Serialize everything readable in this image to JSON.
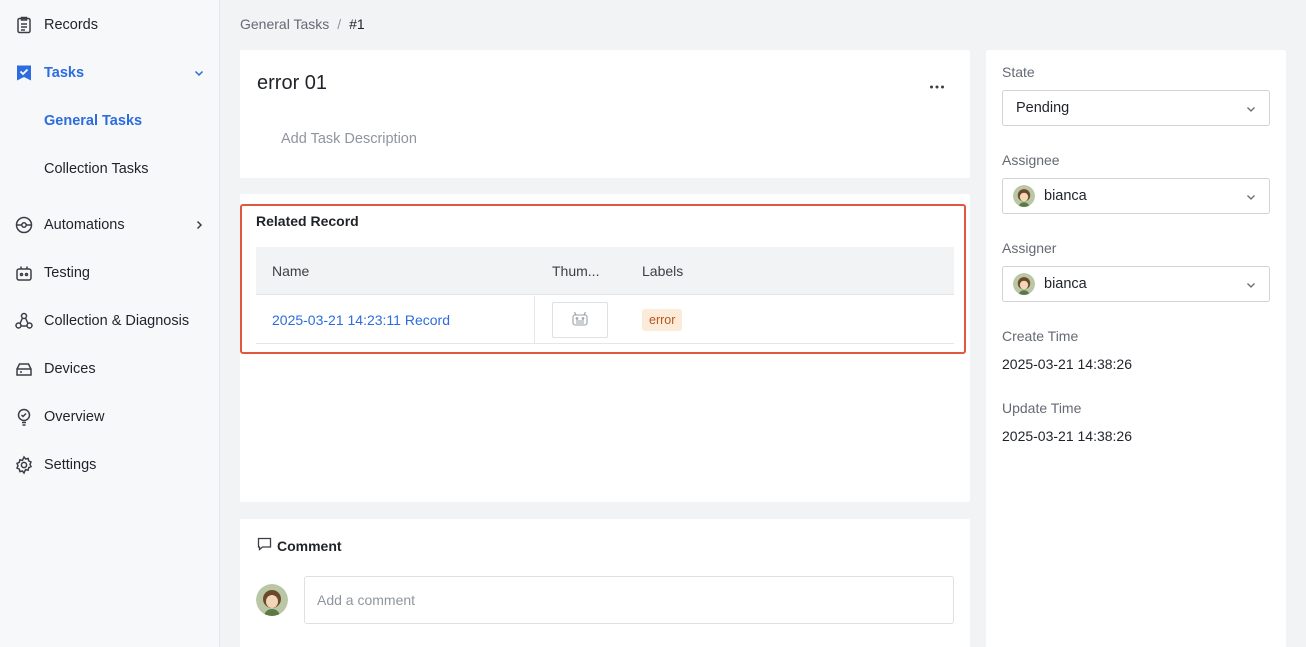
{
  "sidebar": {
    "items": [
      {
        "label": "Records",
        "icon": "clipboard-icon"
      },
      {
        "label": "Tasks",
        "icon": "task-check-icon"
      },
      {
        "label": "General Tasks"
      },
      {
        "label": "Collection Tasks"
      },
      {
        "label": "Automations",
        "icon": "automation-icon"
      },
      {
        "label": "Testing",
        "icon": "testing-icon"
      },
      {
        "label": "Collection & Diagnosis",
        "icon": "diagnosis-icon"
      },
      {
        "label": "Devices",
        "icon": "device-icon"
      },
      {
        "label": "Overview",
        "icon": "overview-icon"
      },
      {
        "label": "Settings",
        "icon": "gear-icon"
      }
    ]
  },
  "breadcrumb": {
    "parent": "General Tasks",
    "separator": "/",
    "current": "#1"
  },
  "task": {
    "title": "error 01",
    "description_placeholder": "Add Task Description"
  },
  "related": {
    "title": "Related Record",
    "columns": [
      "Name",
      "Thum...",
      "Labels"
    ],
    "rows": [
      {
        "name": "2025-03-21 14:23:11 Record",
        "label": "error"
      }
    ]
  },
  "comment": {
    "title": "Comment",
    "placeholder": "Add a comment"
  },
  "details": {
    "state_label": "State",
    "state_value": "Pending",
    "assignee_label": "Assignee",
    "assignee_value": "bianca",
    "assigner_label": "Assigner",
    "assigner_value": "bianca",
    "create_label": "Create Time",
    "create_value": "2025-03-21 14:38:26",
    "update_label": "Update Time",
    "update_value": "2025-03-21 14:38:26"
  },
  "colors": {
    "accent": "#2d6cdf",
    "highlight_border": "#e2583e",
    "tag_bg": "#fdebd9",
    "tag_text": "#b5561a"
  }
}
